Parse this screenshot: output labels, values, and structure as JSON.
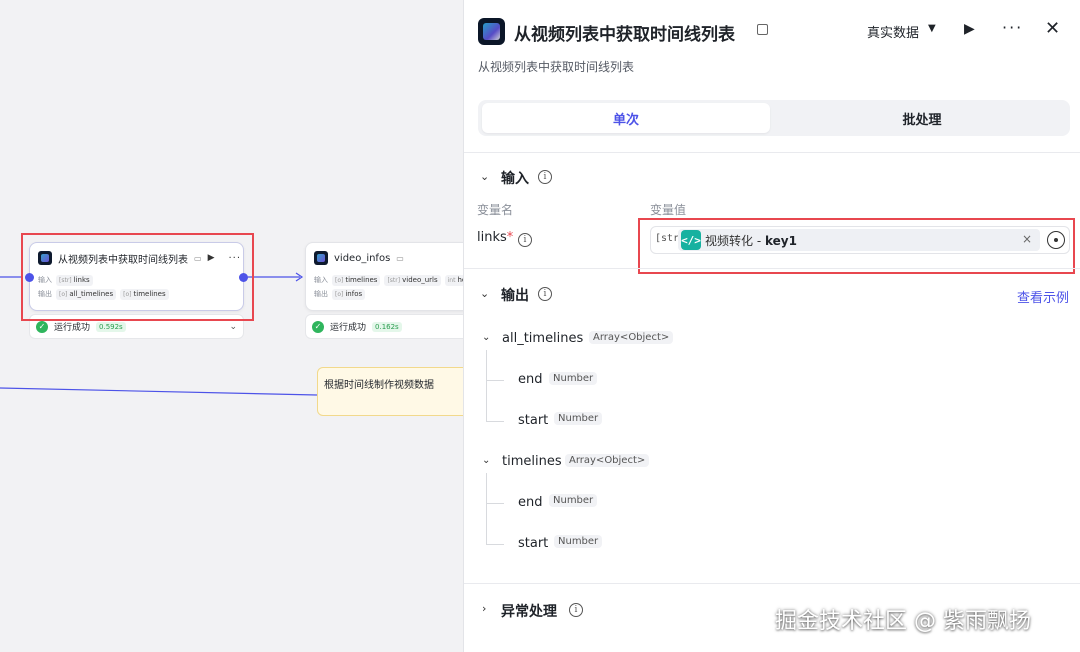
{
  "canvas": {
    "node_a": {
      "title": "从视频列表中获取时间线列表",
      "input_label": "输入",
      "output_label": "输出",
      "inputs": [
        {
          "type": "[str]",
          "name": "links"
        }
      ],
      "outputs": [
        {
          "type": "[o]",
          "name": "all_timelines"
        },
        {
          "type": "[o]",
          "name": "timelines"
        }
      ],
      "status": "运行成功",
      "time": "0.592s"
    },
    "node_b": {
      "title": "video_infos",
      "input_label": "输入",
      "output_label": "输出",
      "inputs": [
        {
          "type": "[o]",
          "name": "timelines"
        },
        {
          "type": "[str]",
          "name": "video_urls"
        },
        {
          "type": "int",
          "name": "heig"
        }
      ],
      "outputs": [
        {
          "type": "[o]",
          "name": "infos"
        }
      ],
      "status": "运行成功",
      "time": "0.162s"
    },
    "note": "根据时间线制作视频数据"
  },
  "panel": {
    "title": "从视频列表中获取时间线列表",
    "description": "从视频列表中获取时间线列表",
    "data_mode": "真实数据",
    "tabs": {
      "single": "单次",
      "batch": "批处理"
    },
    "input_section": {
      "title": "输入",
      "col_name": "变量名",
      "col_value": "变量值",
      "var_name": "links",
      "required_mark": "*",
      "value_type": "[str]",
      "ref_source": "视频转化",
      "ref_sep": " - ",
      "ref_key": "key1"
    },
    "output_section": {
      "title": "输出",
      "example_link": "查看示例",
      "fields": [
        {
          "name": "all_timelines",
          "type": "Array<Object>",
          "children": [
            {
              "name": "end",
              "type": "Number"
            },
            {
              "name": "start",
              "type": "Number"
            }
          ]
        },
        {
          "name": "timelines",
          "type": "Array<Object>",
          "children": [
            {
              "name": "end",
              "type": "Number"
            },
            {
              "name": "start",
              "type": "Number"
            }
          ]
        }
      ]
    },
    "error_section": {
      "title": "异常处理"
    }
  },
  "watermark": "掘金技术社区 @ 紫雨飘扬"
}
